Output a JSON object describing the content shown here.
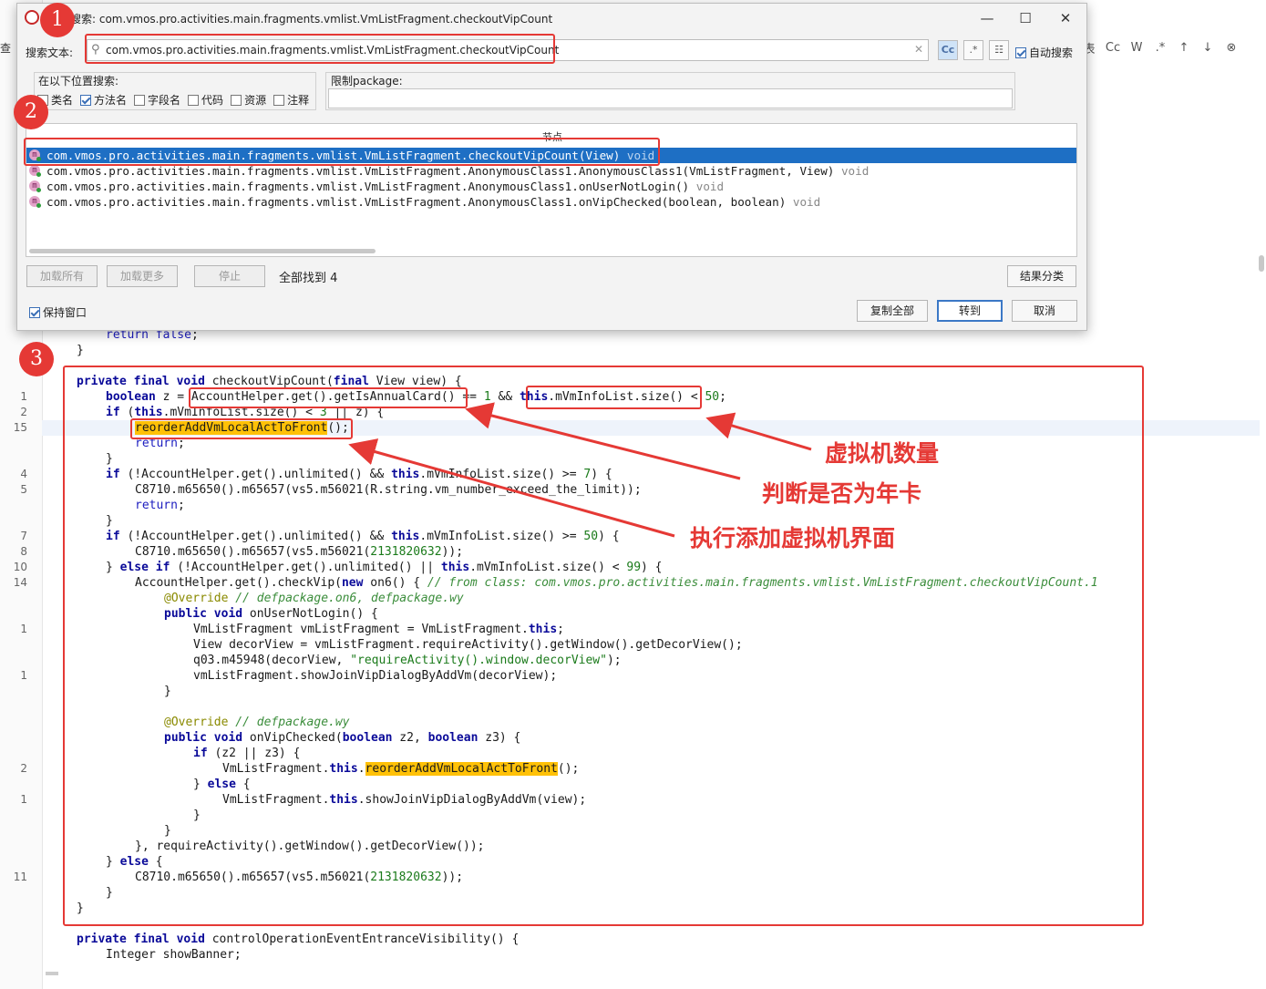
{
  "dialog": {
    "title": "搜索: com.vmos.pro.activities.main.fragments.vmlist.VmListFragment.checkoutVipCount",
    "search_label": "搜索文本:",
    "search_value": "com.vmos.pro.activities.main.fragments.vmlist.VmListFragment.checkoutVipCount",
    "opt_case": "Cc",
    "opt_regex": ".*",
    "auto_search_label": "自动搜索",
    "where_title": "在以下位置搜索:",
    "where_options": [
      "类名",
      "方法名",
      "字段名",
      "代码",
      "资源",
      "注释"
    ],
    "package_title": "限制package:",
    "results_header": "节点",
    "results": [
      {
        "name": "com.vmos.pro.activities.main.fragments.vmlist.VmListFragment.checkoutVipCount(View)",
        "type": "void"
      },
      {
        "name": "com.vmos.pro.activities.main.fragments.vmlist.VmListFragment.AnonymousClass1.AnonymousClass1(VmListFragment, View)",
        "type": "void"
      },
      {
        "name": "com.vmos.pro.activities.main.fragments.vmlist.VmListFragment.AnonymousClass1.onUserNotLogin()",
        "type": "void"
      },
      {
        "name": "com.vmos.pro.activities.main.fragments.vmlist.VmListFragment.AnonymousClass1.onVipChecked(boolean, boolean)",
        "type": "void"
      }
    ],
    "load_all": "加载所有",
    "load_more": "加载更多",
    "stop": "停止",
    "found_text": "全部找到  4",
    "group_results": "结果分类",
    "keep_window": "保持窗口",
    "copy_all": "复制全部",
    "goto": "转到",
    "cancel": "取消"
  },
  "editor": {
    "left_stub": "查",
    "toolbar": [
      "表",
      "Cc",
      "W",
      ".*",
      "↑",
      "↓",
      "⊗"
    ],
    "line_numbers": [
      "1",
      "2",
      "15",
      "4",
      "5",
      "7",
      "8",
      "10",
      "14",
      "1",
      "1",
      "2",
      "1",
      "11"
    ]
  },
  "badges": [
    "1",
    "2",
    "3"
  ],
  "callouts": {
    "vm_count": "虚拟机数量",
    "annual_card": "判断是否为年卡",
    "add_vm": "执行添加虚拟机界面"
  },
  "colors": {
    "accent_red": "#e53935",
    "selection_blue": "#1e6fc4",
    "highlight_yellow": "#ffc107"
  }
}
